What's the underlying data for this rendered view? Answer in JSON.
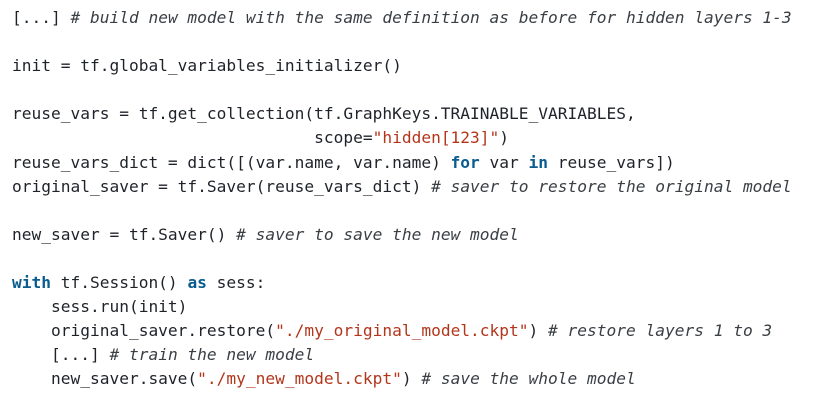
{
  "code_lines": [
    [
      {
        "t": "[...] ",
        "c": "plain"
      },
      {
        "t": "# build new model with the same definition as before for hidden layers 1-3",
        "c": "comment"
      }
    ],
    [],
    [
      {
        "t": "init = tf.global_variables_initializer()",
        "c": "plain"
      }
    ],
    [],
    [
      {
        "t": "reuse_vars = tf.get_collection(tf.GraphKeys.TRAINABLE_VARIABLES,",
        "c": "plain"
      }
    ],
    [
      {
        "t": "                               scope=",
        "c": "plain"
      },
      {
        "t": "\"hidden[123]\"",
        "c": "string"
      },
      {
        "t": ")",
        "c": "plain"
      }
    ],
    [
      {
        "t": "reuse_vars_dict = dict([(var.name, var.name) ",
        "c": "plain"
      },
      {
        "t": "for",
        "c": "keyword"
      },
      {
        "t": " var ",
        "c": "plain"
      },
      {
        "t": "in",
        "c": "keyword"
      },
      {
        "t": " reuse_vars])",
        "c": "plain"
      }
    ],
    [
      {
        "t": "original_saver = tf.Saver(reuse_vars_dict) ",
        "c": "plain"
      },
      {
        "t": "# saver to restore the original model",
        "c": "comment"
      }
    ],
    [],
    [
      {
        "t": "new_saver = tf.Saver() ",
        "c": "plain"
      },
      {
        "t": "# saver to save the new model",
        "c": "comment"
      }
    ],
    [],
    [
      {
        "t": "with",
        "c": "keyword"
      },
      {
        "t": " tf.Session() ",
        "c": "plain"
      },
      {
        "t": "as",
        "c": "keyword"
      },
      {
        "t": " sess:",
        "c": "plain"
      }
    ],
    [
      {
        "t": "    sess.run(init)",
        "c": "plain"
      }
    ],
    [
      {
        "t": "    original_saver.restore(",
        "c": "plain"
      },
      {
        "t": "\"./my_original_model.ckpt\"",
        "c": "string"
      },
      {
        "t": ") ",
        "c": "plain"
      },
      {
        "t": "# restore layers 1 to 3",
        "c": "comment"
      }
    ],
    [
      {
        "t": "    [...] ",
        "c": "plain"
      },
      {
        "t": "# train the new model",
        "c": "comment"
      }
    ],
    [
      {
        "t": "    new_saver.save(",
        "c": "plain"
      },
      {
        "t": "\"./my_new_model.ckpt\"",
        "c": "string"
      },
      {
        "t": ") ",
        "c": "plain"
      },
      {
        "t": "# save the whole model",
        "c": "comment"
      }
    ]
  ],
  "colors": {
    "text": "#1f2329",
    "comment": "#3a3f44",
    "string": "#b3361c",
    "keyword": "#0a5c8f",
    "background": "#ffffff"
  }
}
